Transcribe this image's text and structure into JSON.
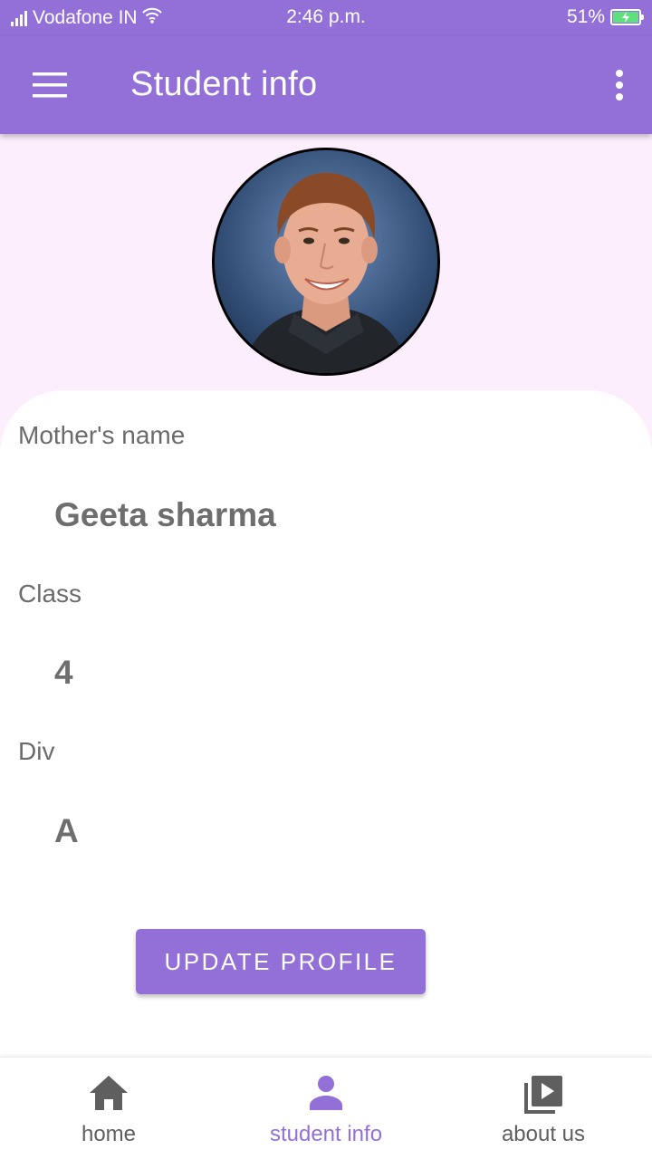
{
  "status_bar": {
    "carrier": "Vodafone IN",
    "time": "2:46 p.m.",
    "battery": "51%"
  },
  "app_bar": {
    "title": "Student info"
  },
  "fields": [
    {
      "label": "Mother's name",
      "value": "Geeta sharma"
    },
    {
      "label": "Class",
      "value": "4"
    },
    {
      "label": "Div",
      "value": "A"
    }
  ],
  "update_button": {
    "label": "UPDATE PROFILE"
  },
  "bottom_nav": {
    "items": [
      {
        "label": "home",
        "icon": "home-icon",
        "active": false
      },
      {
        "label": "student info",
        "icon": "person-icon",
        "active": true
      },
      {
        "label": "about us",
        "icon": "video-library-icon",
        "active": false
      }
    ]
  },
  "colors": {
    "primary": "#9370d8",
    "background": "#fdeefd",
    "card": "#ffffff",
    "text_label": "#6b6b6b",
    "text_value": "#6e6e6e",
    "nav_inactive": "#5f5f5f"
  }
}
